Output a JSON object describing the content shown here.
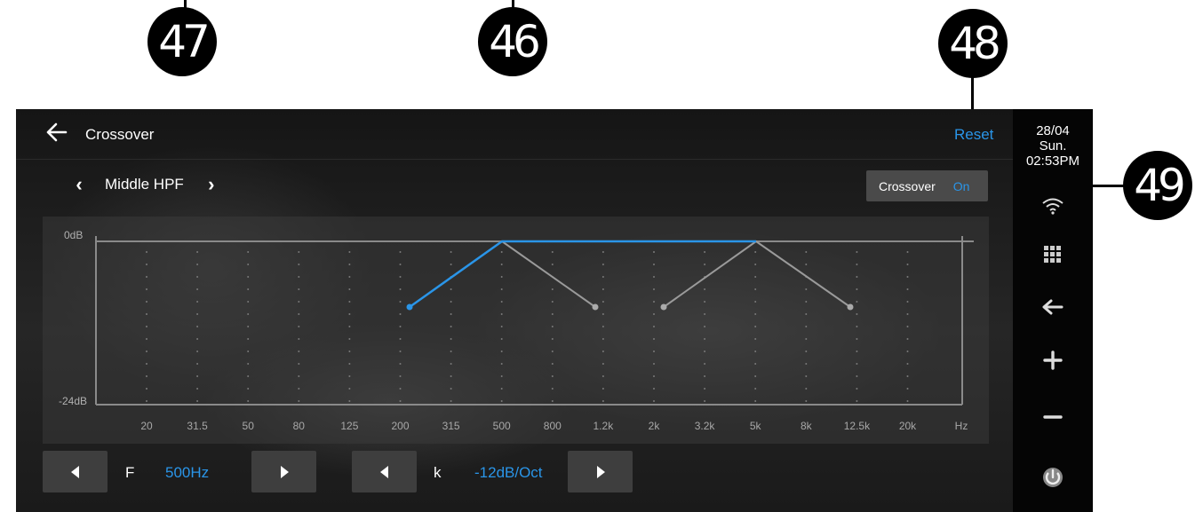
{
  "callouts": [
    "47",
    "46",
    "48",
    "49"
  ],
  "header": {
    "title": "Crossover",
    "reset_label": "Reset"
  },
  "channel": {
    "label": "Middle HPF"
  },
  "crossover_toggle": {
    "label": "Crossover",
    "state": "On"
  },
  "status": {
    "date": "28/04",
    "day": "Sun.",
    "time": "02:53PM"
  },
  "graph": {
    "y_labels": [
      "0dB",
      "-24dB"
    ],
    "x_labels": [
      "20",
      "31.5",
      "50",
      "80",
      "125",
      "200",
      "315",
      "500",
      "800",
      "1.2k",
      "2k",
      "3.2k",
      "5k",
      "8k",
      "12.5k",
      "20k",
      "Hz"
    ]
  },
  "controls": {
    "frequency": {
      "label": "F",
      "value": "500Hz"
    },
    "slope": {
      "label": "k",
      "value": "-12dB/Oct"
    }
  },
  "colors": {
    "accent": "#2a95e8",
    "inactive_curve": "#9a9a9a",
    "callout": "#000000"
  },
  "icons": [
    "back-arrow-icon",
    "chevron-left-icon",
    "chevron-right-icon",
    "wifi-icon",
    "apps-grid-icon",
    "return-icon",
    "volume-up-icon",
    "volume-down-icon",
    "power-icon"
  ]
}
